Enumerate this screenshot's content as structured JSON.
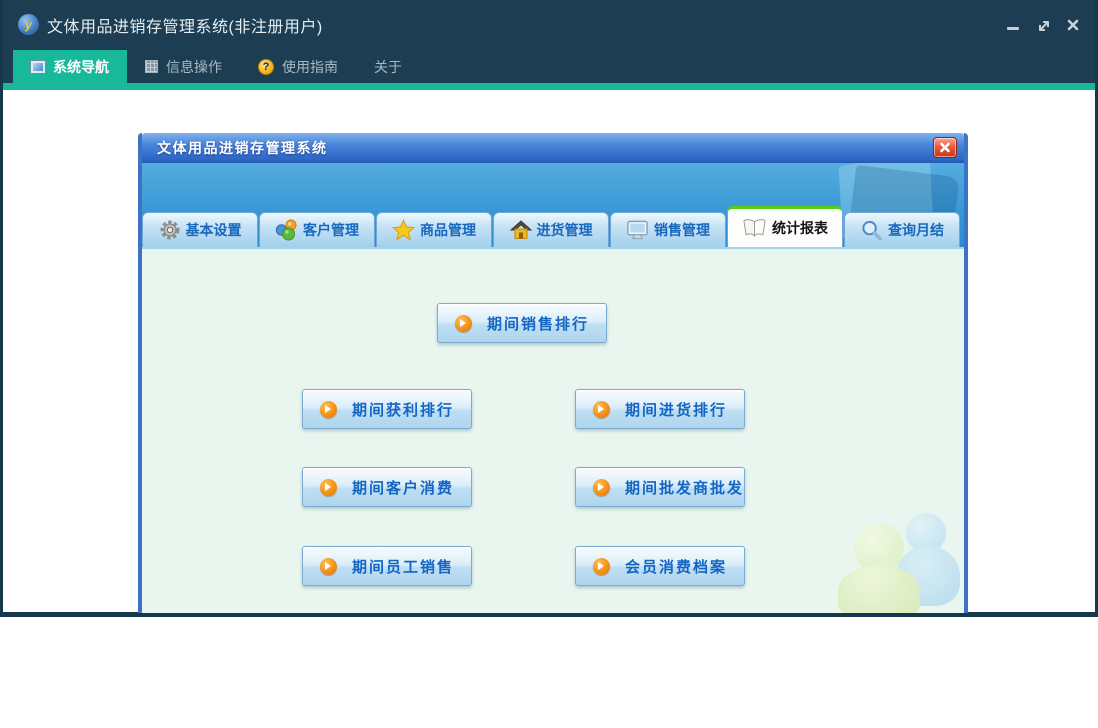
{
  "app": {
    "title": "文体用品进销存管理系统(非注册用户)",
    "logo_letter": "y"
  },
  "menu": {
    "items": [
      {
        "label": "系统导航",
        "icon": "window-icon",
        "active": true
      },
      {
        "label": "信息操作",
        "icon": "grid-icon",
        "active": false
      },
      {
        "label": "使用指南",
        "icon": "help-icon",
        "glyph": "?",
        "active": false
      },
      {
        "label": "关于",
        "icon": "",
        "active": false
      }
    ]
  },
  "dialog": {
    "title": "文体用品进销存管理系统",
    "tabs": [
      {
        "label": "基本设置",
        "icon": "gear-icon",
        "selected": false
      },
      {
        "label": "客户管理",
        "icon": "customers-icon",
        "selected": false
      },
      {
        "label": "商品管理",
        "icon": "star-icon",
        "selected": false
      },
      {
        "label": "进货管理",
        "icon": "house-icon",
        "selected": false
      },
      {
        "label": "销售管理",
        "icon": "monitor-icon",
        "selected": false
      },
      {
        "label": "统计报表",
        "icon": "book-icon",
        "selected": true
      },
      {
        "label": "查询月结",
        "icon": "search-icon",
        "selected": false
      }
    ],
    "report_buttons": [
      {
        "label": "期间销售排行"
      },
      {
        "label": "期间获利排行"
      },
      {
        "label": "期间进货排行"
      },
      {
        "label": "期间客户消费"
      },
      {
        "label": "期间批发商批发"
      },
      {
        "label": "期间员工销售"
      },
      {
        "label": "会员消费档案"
      }
    ]
  },
  "colors": {
    "titlebar_bg": "#1d3d52",
    "accent_green": "#17b99a",
    "menu_inactive_text": "#a7bac4",
    "dialog_border_blue": "#3e72c4",
    "dialog_titlebar_blue": "#2d66c6",
    "banner_blue": "#3a97d6",
    "tab_text_blue": "#1767bd",
    "selected_tab_accent_green": "#58cc12",
    "content_bg_mint": "#e9f6ef",
    "button_text_blue": "#1565c5",
    "arrow_orange": "#f59018",
    "close_button_red": "#d84a30"
  }
}
